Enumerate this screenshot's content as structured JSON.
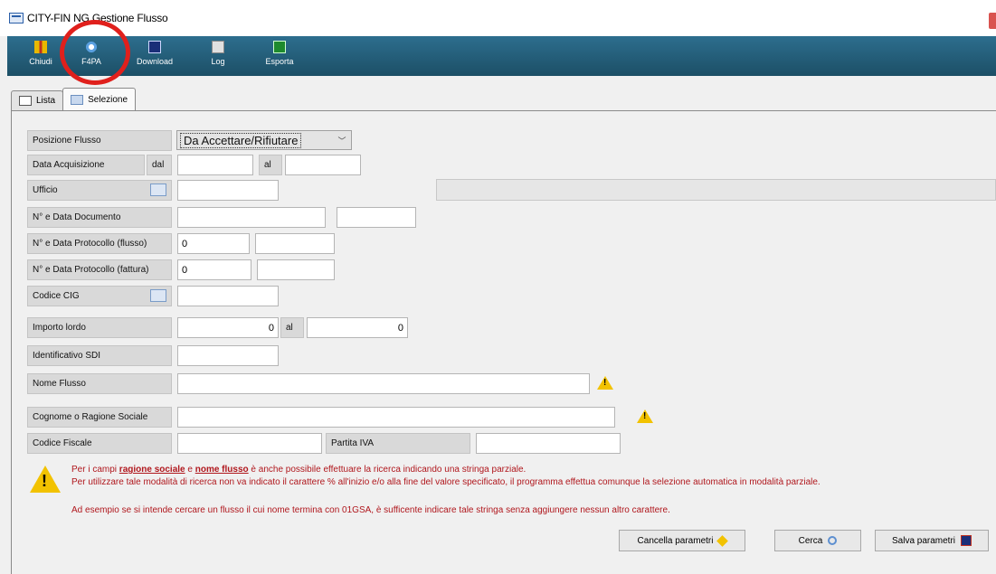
{
  "window": {
    "title": "CITY-FIN      NG  Gestione Flusso"
  },
  "toolbar": {
    "buttons": [
      {
        "label": "Chiudi",
        "icon": "exit-door-icon"
      },
      {
        "label": "F4PA",
        "icon": "eye-icon"
      },
      {
        "label": "Download",
        "icon": "download-icon"
      },
      {
        "label": "Log",
        "icon": "log-document-icon"
      },
      {
        "label": "Esporta",
        "icon": "excel-export-icon"
      }
    ]
  },
  "tabs": [
    {
      "label": "Lista"
    },
    {
      "label": "Selezione"
    }
  ],
  "form": {
    "posizione_flusso": {
      "label": "Posizione Flusso",
      "value": "Da Accettare/Rifiutare"
    },
    "data_acquisizione": {
      "label": "Data Acquisizione",
      "dal": "dal",
      "al": "al",
      "from": "",
      "to": ""
    },
    "ufficio": {
      "label": "Ufficio",
      "value": ""
    },
    "documento": {
      "label": "N° e Data Documento",
      "number": "",
      "date": ""
    },
    "protocollo_flusso": {
      "label": "N° e Data Protocollo (flusso)",
      "number": "0",
      "date": ""
    },
    "protocollo_fattura": {
      "label": "N° e Data Protocollo (fattura)",
      "number": "0",
      "date": ""
    },
    "codice_cig": {
      "label": "Codice CIG",
      "value": ""
    },
    "importo_lordo": {
      "label": "Importo lordo",
      "from": "0",
      "al": "al",
      "to": "0"
    },
    "identificativo_sdi": {
      "label": "Identificativo SDI",
      "value": ""
    },
    "nome_flusso": {
      "label": "Nome Flusso",
      "value": ""
    },
    "cognome_ragione": {
      "label": "Cognome o Ragione Sociale",
      "value": ""
    },
    "codice_fiscale": {
      "label": "Codice Fiscale",
      "value": ""
    },
    "partita_iva": {
      "label": "Partita IVA",
      "value": ""
    }
  },
  "notes": {
    "line1_a": "Per i campi ",
    "line1_b": "ragione sociale",
    "line1_c": " e ",
    "line1_d": "nome flusso",
    "line1_e": " è anche possibile effettuare la ricerca indicando una stringa parziale.",
    "line2": "Per utilizzare tale modalità di ricerca non va indicato il carattere % all'inizio e/o alla fine del valore specificato, il programma effettua comunque la selezione automatica in modalità parziale.",
    "line3": "Ad esempio se si intende cercare un flusso il cui nome termina con 01GSA, è sufficente indicare tale stringa senza aggiungere nessun altro carattere."
  },
  "buttons": {
    "cancella": "Cancella parametri",
    "cerca": "Cerca",
    "salva": "Salva parametri"
  }
}
